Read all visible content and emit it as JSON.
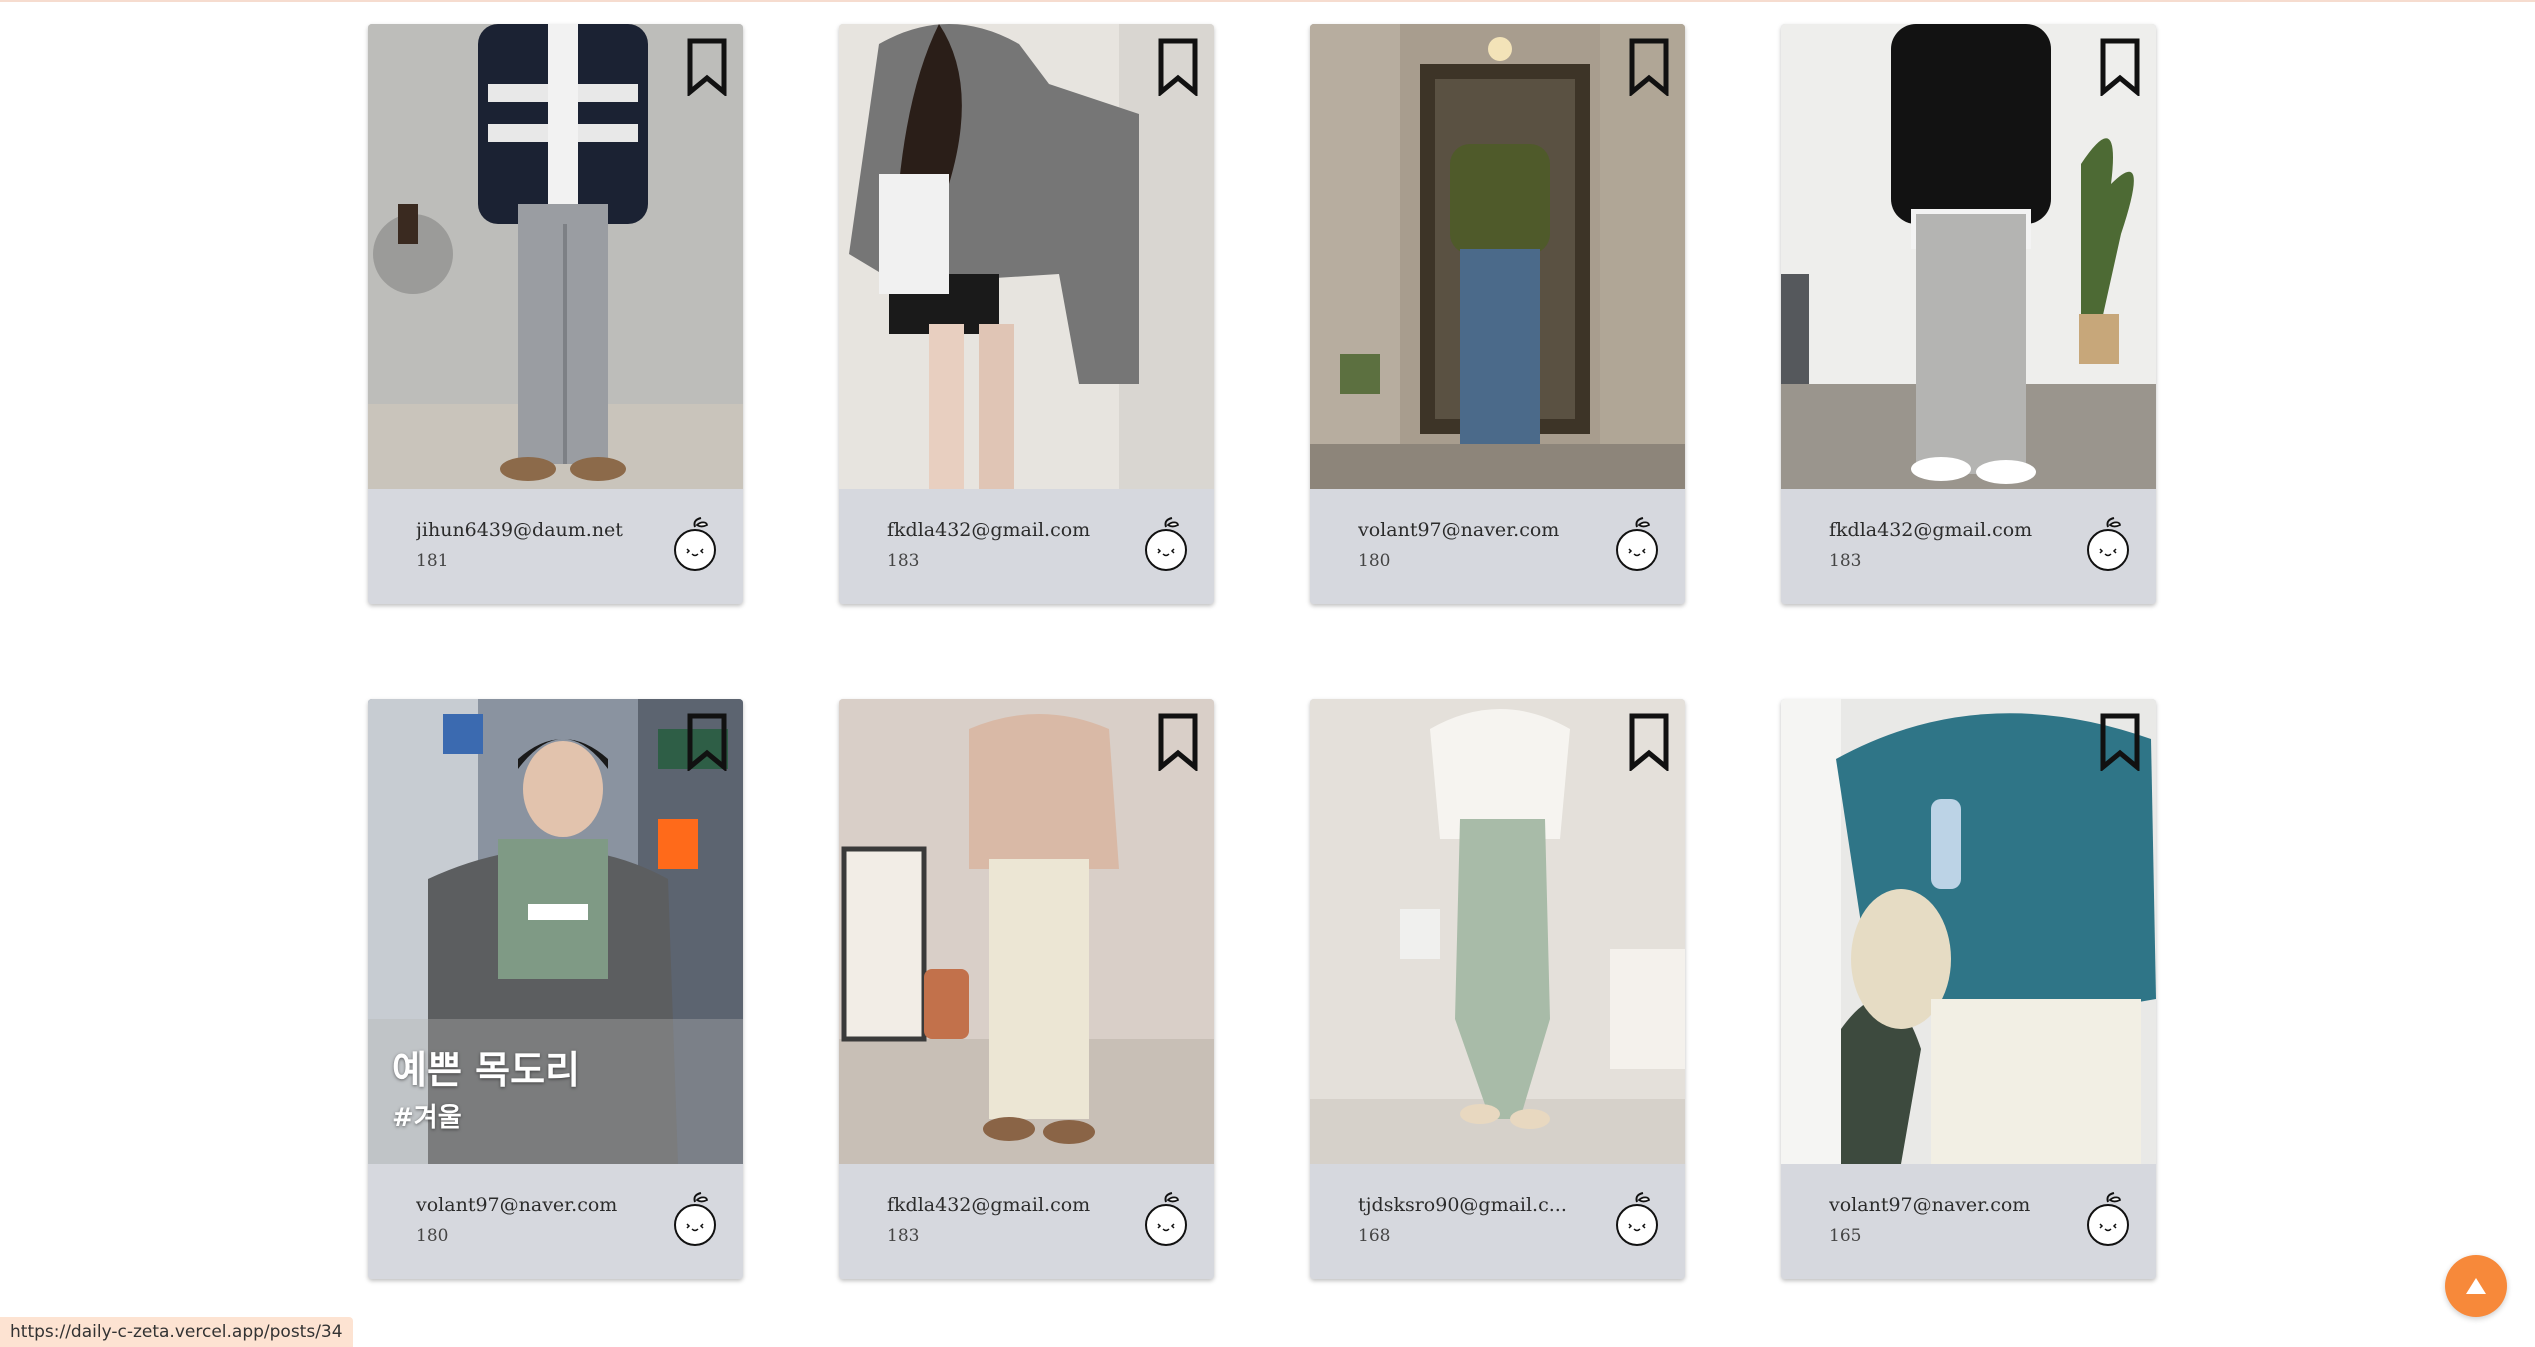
{
  "cards": [
    {
      "email": "jihun6439@daum.net",
      "height": "181",
      "photo": "knit-cardigan-gray-pants"
    },
    {
      "email": "fkdla432@gmail.com",
      "height": "183",
      "photo": "gray-sweater-leather-skirt"
    },
    {
      "email": "volant97@naver.com",
      "height": "180",
      "photo": "green-sweater-jeans"
    },
    {
      "email": "fkdla432@gmail.com",
      "height": "183",
      "photo": "black-sweater-gray-pants"
    },
    {
      "email": "volant97@naver.com",
      "height": "180",
      "photo": "scarf-winter-coat",
      "overlay_title": "예쁜 목도리",
      "overlay_tag": "#겨울"
    },
    {
      "email": "fkdla432@gmail.com",
      "height": "183",
      "photo": "beige-turtleneck-cream-pants"
    },
    {
      "email": "tjdsksro90@gmail.c...",
      "height": "168",
      "photo": "white-blouse-mint-pants"
    },
    {
      "email": "volant97@naver.com",
      "height": "165",
      "photo": "teal-cable-cardigan"
    }
  ],
  "status_bar": {
    "url": "https://daily-c-zeta.vercel.app/posts/34"
  },
  "icons": {
    "bookmark": "bookmark-icon",
    "like": "apple-face-icon",
    "scroll_top": "arrow-up-icon"
  },
  "colors": {
    "accent": "#f7893a",
    "card_footer": "#d6d8de",
    "status_bg": "#fde3d2"
  }
}
